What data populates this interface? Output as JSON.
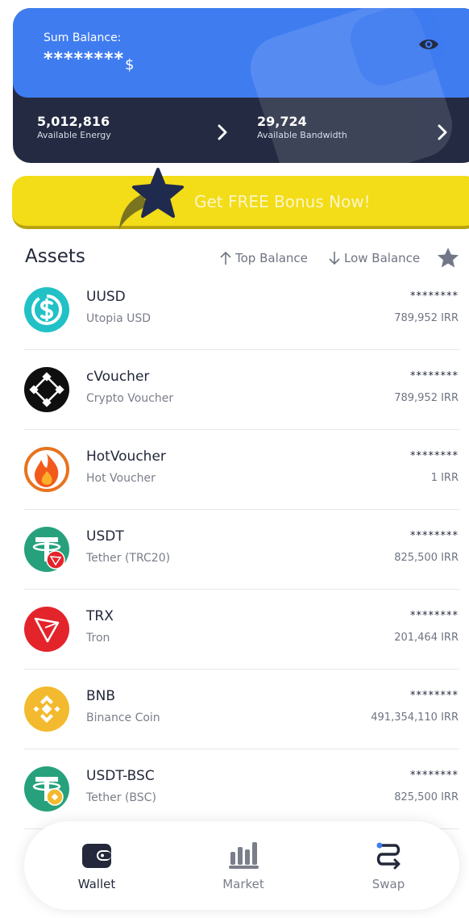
{
  "balance_card": {
    "sum_label": "Sum Balance:",
    "sum_value": "********",
    "currency_symbol": "$",
    "energy_value": "5,012,816",
    "energy_label": "Available Energy",
    "bandwidth_value": "29,724",
    "bandwidth_label": "Available Bandwidth",
    "colors": {
      "top": "#3f7cf0",
      "bottom": "#232a41"
    }
  },
  "bonus_banner": {
    "text": "Get FREE Bonus Now!",
    "color": "#f3dc18"
  },
  "assets": {
    "title": "Assets",
    "sort_top_label": "Top Balance",
    "sort_low_label": "Low Balance",
    "items": [
      {
        "symbol": "UUSD",
        "name": "Utopia USD",
        "hidden_amount": "********",
        "value": "789,952 IRR",
        "icon": "utopia-usd-icon"
      },
      {
        "symbol": "cVoucher",
        "name": "Crypto Voucher",
        "hidden_amount": "********",
        "value": "789,952 IRR",
        "icon": "crypto-voucher-icon"
      },
      {
        "symbol": "HotVoucher",
        "name": "Hot Voucher",
        "hidden_amount": "********",
        "value": "1 IRR",
        "icon": "hot-voucher-icon"
      },
      {
        "symbol": "USDT",
        "name": "Tether (TRC20)",
        "hidden_amount": "********",
        "value": "825,500 IRR",
        "icon": "tether-trc20-icon"
      },
      {
        "symbol": "TRX",
        "name": "Tron",
        "hidden_amount": "********",
        "value": "201,464 IRR",
        "icon": "tron-icon"
      },
      {
        "symbol": "BNB",
        "name": "Binance Coin",
        "hidden_amount": "********",
        "value": "491,354,110 IRR",
        "icon": "binance-coin-icon"
      },
      {
        "symbol": "USDT-BSC",
        "name": "Tether (BSC)",
        "hidden_amount": "********",
        "value": "825,500 IRR",
        "icon": "tether-bsc-icon"
      }
    ]
  },
  "bottom_nav": {
    "wallet_label": "Wallet",
    "market_label": "Market",
    "swap_label": "Swap",
    "active": "Wallet"
  }
}
